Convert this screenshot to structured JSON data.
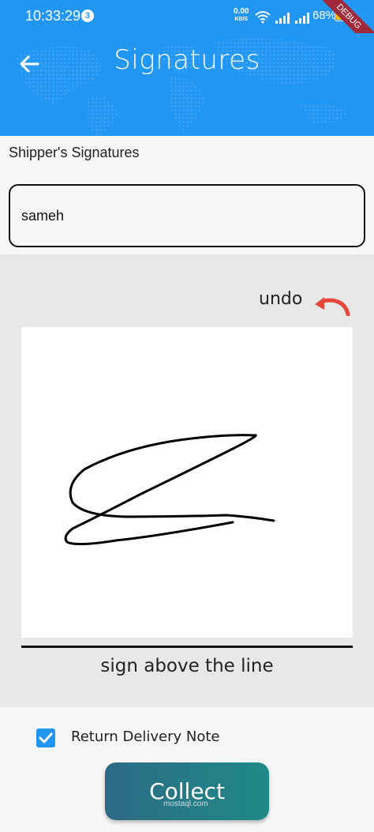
{
  "status_bar": {
    "time": "10:33:29",
    "notification_count": "3",
    "net_speed_value": "0.00",
    "net_speed_unit": "KB/S",
    "battery_percent": "68%",
    "battery_level": 0.68,
    "debug_banner": "DEBUG"
  },
  "app_bar": {
    "title": "Signatures",
    "background_color": "#2196f3",
    "back_icon": "arrow-back-icon"
  },
  "form": {
    "section_label": "Shipper's Signatures",
    "name_value": "sameh"
  },
  "signature_pad": {
    "undo_label": "undo",
    "undo_icon": "undo-icon",
    "undo_color": "#e8483b",
    "hint": "sign above the line"
  },
  "options": {
    "return_note_label": "Return Delivery Note",
    "return_note_checked": true
  },
  "actions": {
    "collect_label": "Collect",
    "watermark": "mostaql.com"
  }
}
